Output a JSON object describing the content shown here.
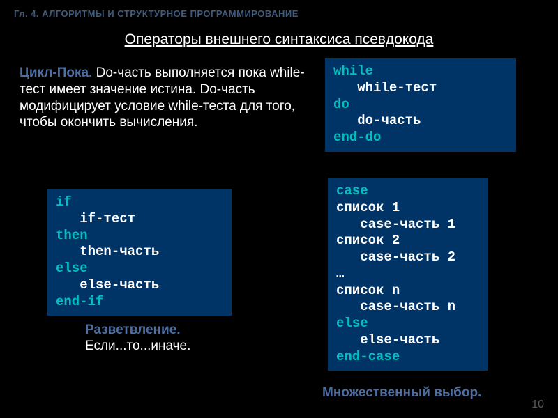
{
  "chapter": "Гл. 4. АЛГОРИТМЫ И СТРУКТУРНОЕ ПРОГРАММИРОВАНИЕ",
  "title": "Операторы внешнего синтаксиса псевдокода",
  "while_block": {
    "lead": "Цикл-Пока.",
    "text": " Do-часть выполняется пока while-тест имеет значение истина. Do-часть модифицирует условие while-теста для того, чтобы окончить вычисления.",
    "code": {
      "l1_kw": "while",
      "l2_txt": "   while-тест",
      "l3_kw": "do",
      "l4_txt": "   do-часть",
      "l5_kw": "end-do"
    }
  },
  "if_block": {
    "code": {
      "l1_kw": "if",
      "l2_txt": "   if-тест",
      "l3_kw": "then",
      "l4_txt": "   then-часть",
      "l5_kw": "else",
      "l6_txt": "   else-часть",
      "l7_kw": "end-if"
    },
    "lead": "Разветвление.",
    "text": " Если...то...иначе."
  },
  "case_block": {
    "code": {
      "l1_kw": "case",
      "l2_txt": "список 1",
      "l3_txt": "   case-часть 1",
      "l4_txt": "список 2",
      "l5_txt": "   case-часть 2",
      "l6_txt": "…",
      "l7_txt": "список n",
      "l8_txt": "   case-часть n",
      "l9_kw": "else",
      "l10_txt": "   else-часть",
      "l11_kw": "end-case"
    },
    "lead": "Множественный выбор."
  },
  "page_number": "10"
}
